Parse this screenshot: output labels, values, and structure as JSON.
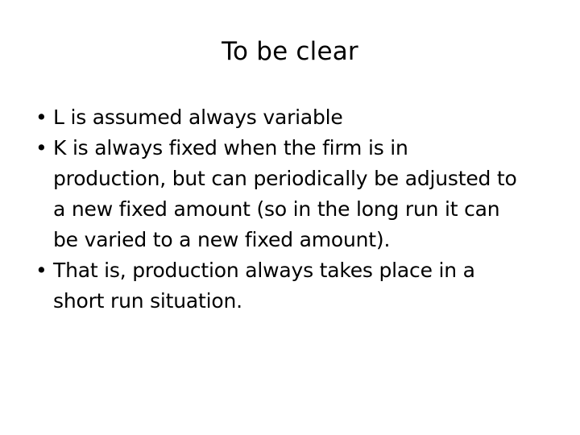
{
  "slide": {
    "title": "To be clear",
    "background_color": "#ffffff",
    "text_color": "#000000",
    "bullet_glyph": "•",
    "bullets": [
      {
        "marker": "•",
        "lines": [
          "L is assumed always variable"
        ]
      },
      {
        "marker": "•",
        "lines": [
          "K is always fixed when the firm is in",
          "production, but can periodically be adjusted to",
          "a new fixed amount (so in the long run it can",
          "be varied to a new fixed amount)."
        ]
      },
      {
        "marker": "•",
        "lines": [
          "That is, production always takes place in a",
          "short run situation."
        ]
      }
    ]
  }
}
